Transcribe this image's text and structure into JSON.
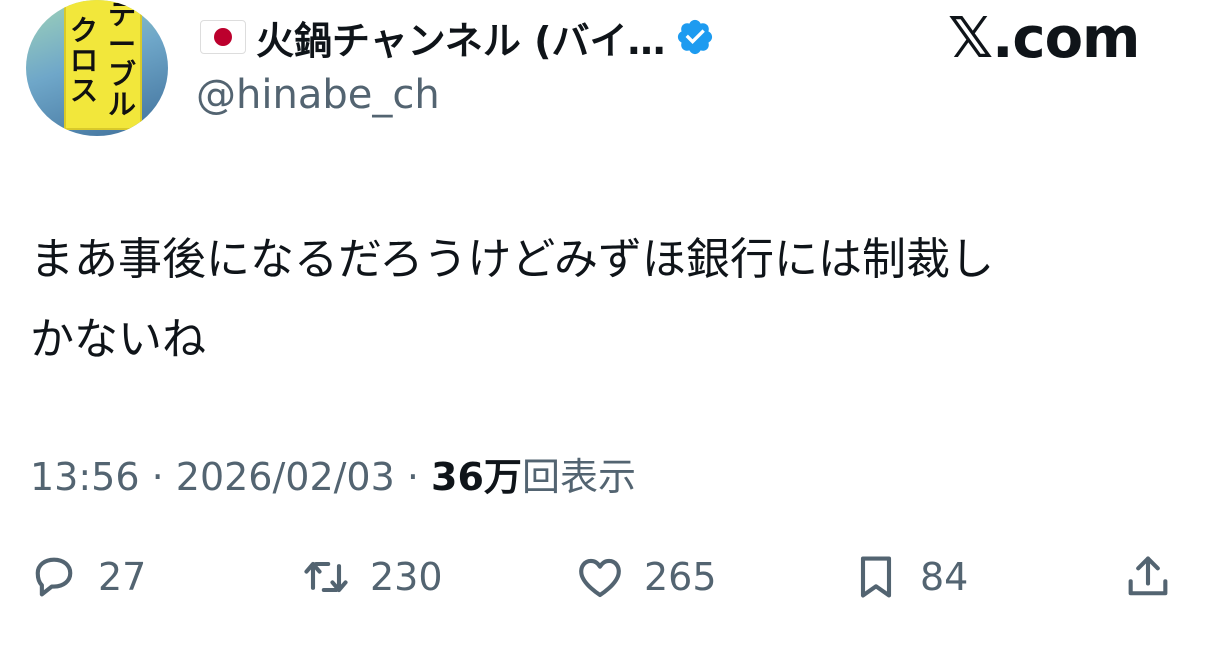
{
  "header": {
    "display_name": "火鍋チャンネル (バイ…",
    "handle": "@hinabe_ch",
    "brand": "𝕏.com",
    "flag_icon": "japan-flag-icon",
    "verified_icon": "verified-badge-icon",
    "verified_color": "#1d9bf0"
  },
  "avatar": {
    "sign_col1": "テ\nー\nブ\nル",
    "sign_col2": "ク\nロ\nス"
  },
  "tweet": {
    "text_line1": "まあ事後になるだろうけどみずほ銀行には制裁し",
    "text_line2": "かないね"
  },
  "meta": {
    "time": "13:56",
    "separator": " · ",
    "date": "2026/02/03",
    "views_count": "36万",
    "views_label": "回表示"
  },
  "actions": {
    "reply_count": "27",
    "retweet_count": "230",
    "like_count": "265",
    "bookmark_count": "84"
  },
  "colors": {
    "text_primary": "#0f1419",
    "text_secondary": "#536471"
  }
}
